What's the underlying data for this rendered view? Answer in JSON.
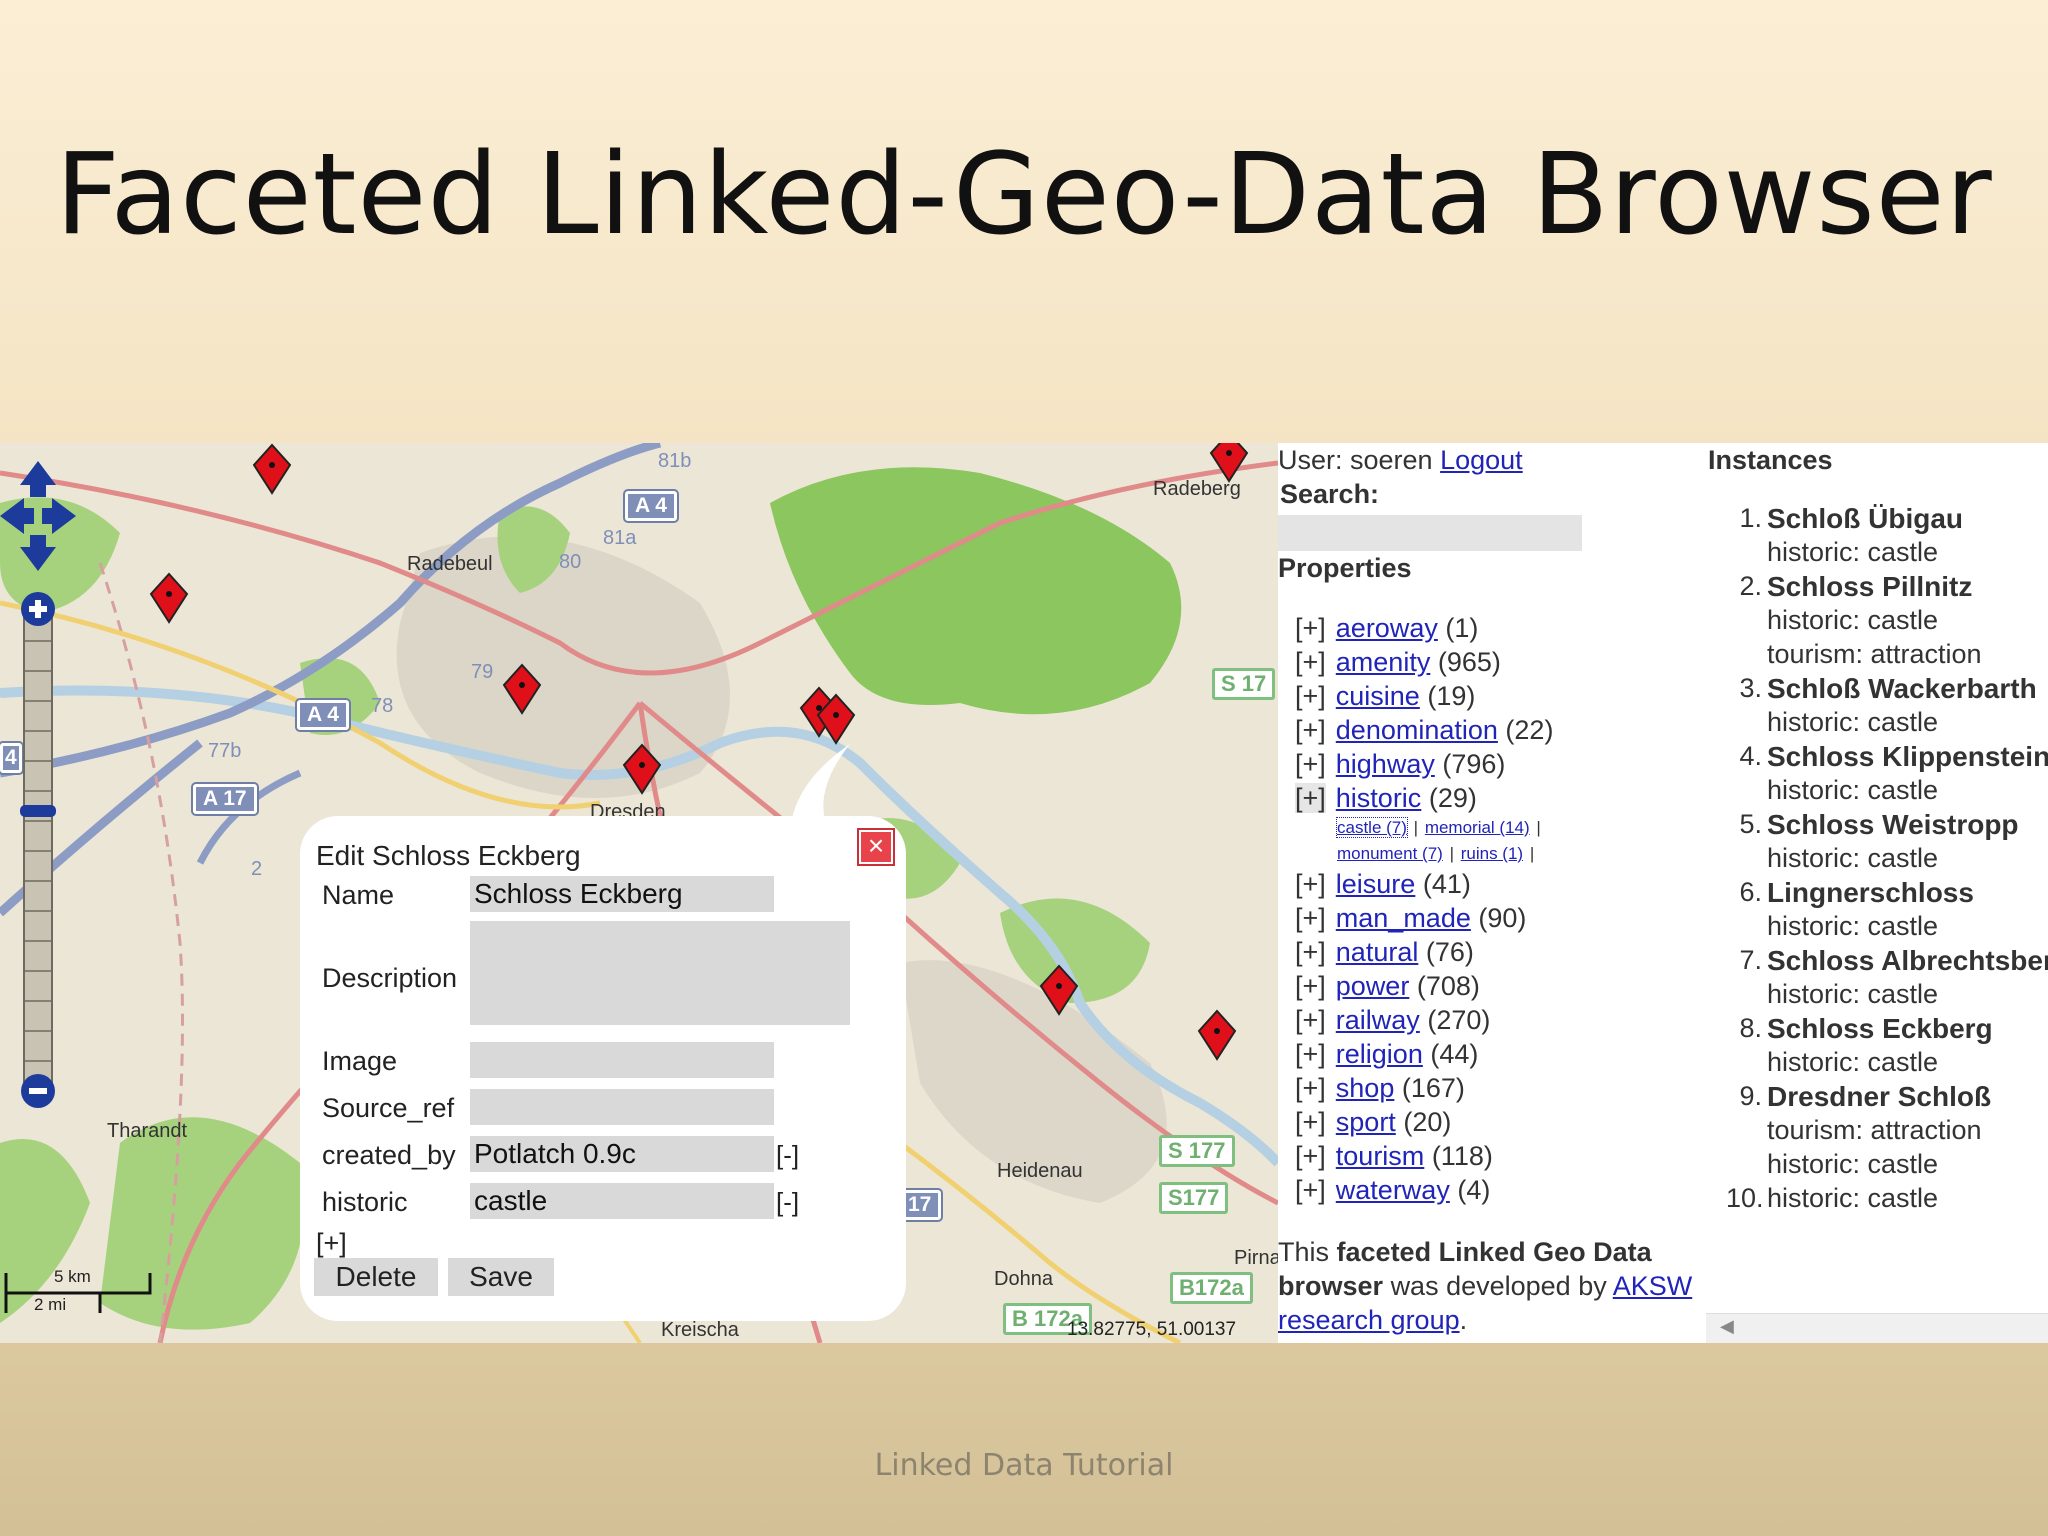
{
  "slide": {
    "title": "Faceted Linked-Geo-Data Browser",
    "footer": "Linked Data Tutorial"
  },
  "map": {
    "places": {
      "radebeul": "Radebeul",
      "radeberg": "Radeberg",
      "dresden": "Dresden",
      "tharandt": "Tharandt",
      "heidenau": "Heidenau",
      "dohna": "Dohna",
      "kreischa": "Kreischa",
      "pirna": "Pirna"
    },
    "shields": {
      "a4_top": "A 4",
      "a4_left": "A 4",
      "a17": "A 17",
      "a17_bottom": "17",
      "s17": "S 17",
      "s177a": "S 177",
      "s177b": "S177",
      "b172a": "B172a",
      "b172a_bottom": "B 172a",
      "r81b": "81b",
      "r81a": "81a",
      "r80": "80",
      "r79": "79",
      "r78": "78",
      "r77b": "77b",
      "r2": "2",
      "r4": "4"
    },
    "coordinates": "13.82775, 51.00137",
    "scale_km": "5 km",
    "scale_mi": "2 mi",
    "colors": {
      "forest": "#a6d27e",
      "big_forest": "#8cc65e",
      "marker": "#e0101a",
      "autobahn": "#8d9cc4"
    }
  },
  "popup": {
    "title": "Edit Schloss Eckberg",
    "fields": {
      "name_label": "Name",
      "name_value": "Schloss Eckberg",
      "description_label": "Description",
      "image_label": "Image",
      "source_ref_label": "Source_ref",
      "created_by_label": "created_by",
      "created_by_value": "Potlatch 0.9c",
      "historic_label": "historic",
      "historic_value": "castle",
      "remove": "[-]",
      "add": "[+]"
    },
    "delete_label": "Delete",
    "save_label": "Save"
  },
  "panel": {
    "user_label": "User: soeren",
    "logout": "Logout",
    "search_label": "Search:",
    "properties_heading": "Properties",
    "toggle": "[+]",
    "properties": [
      {
        "name": "aeroway",
        "count": "(1)"
      },
      {
        "name": "amenity",
        "count": "(965)"
      },
      {
        "name": "cuisine",
        "count": "(19)"
      },
      {
        "name": "denomination",
        "count": "(22)"
      },
      {
        "name": "highway",
        "count": "(796)"
      },
      {
        "name": "historic",
        "count": "(29)"
      },
      {
        "name": "leisure",
        "count": "(41)"
      },
      {
        "name": "man_made",
        "count": "(90)"
      },
      {
        "name": "natural",
        "count": "(76)"
      },
      {
        "name": "power",
        "count": "(708)"
      },
      {
        "name": "railway",
        "count": "(270)"
      },
      {
        "name": "religion",
        "count": "(44)"
      },
      {
        "name": "shop",
        "count": "(167)"
      },
      {
        "name": "sport",
        "count": "(20)"
      },
      {
        "name": "tourism",
        "count": "(118)"
      },
      {
        "name": "waterway",
        "count": "(4)"
      }
    ],
    "historic_values": {
      "castle": "castle (7)",
      "memorial": "memorial (14)",
      "monument": "monument (7)",
      "ruins": "ruins (1)",
      "sep": "|"
    },
    "about": {
      "text1": "This",
      "bold": "faceted Linked Geo Data browser",
      "text2": "was developed by",
      "link": "AKSW research group",
      "end": "."
    }
  },
  "instances": {
    "heading": "Instances",
    "items": [
      {
        "num": "1.",
        "name": "Schloß Übigau",
        "lines": [
          "historic: castle"
        ]
      },
      {
        "num": "2.",
        "name": "Schloss Pillnitz",
        "lines": [
          "historic: castle",
          "tourism: attraction"
        ]
      },
      {
        "num": "3.",
        "name": "Schloß Wackerbarth",
        "lines": [
          "historic: castle"
        ]
      },
      {
        "num": "4.",
        "name": "Schloss Klippenstein",
        "lines": [
          "historic: castle"
        ]
      },
      {
        "num": "5.",
        "name": "Schloss Weistropp",
        "lines": [
          "historic: castle"
        ]
      },
      {
        "num": "6.",
        "name": "Lingnerschloss",
        "lines": [
          "historic: castle"
        ]
      },
      {
        "num": "7.",
        "name": "Schloss Albrechtsber",
        "lines": [
          "historic: castle"
        ]
      },
      {
        "num": "8.",
        "name": "Schloss Eckberg",
        "lines": [
          "historic: castle"
        ]
      },
      {
        "num": "9.",
        "name": "Dresdner Schloß",
        "lines": [
          "tourism: attraction",
          "historic: castle"
        ]
      },
      {
        "num": "10.",
        "name": "",
        "lines": [
          "historic: castle"
        ]
      }
    ]
  }
}
